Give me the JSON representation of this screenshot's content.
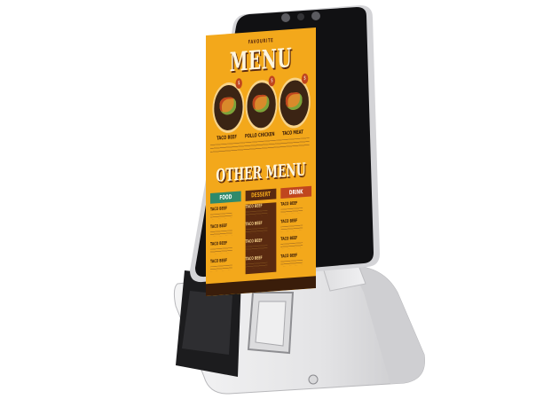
{
  "screen": {
    "brand": "FAVOURITE",
    "title": "MENU",
    "featured": [
      {
        "label": "TACO BEEF",
        "price": "$"
      },
      {
        "label": "POLLO CHICKEN",
        "price": "$"
      },
      {
        "label": "TACO MEAT",
        "price": "$"
      }
    ],
    "section_title": "OTHER MENU",
    "categories": [
      {
        "label": "FOOD",
        "color": "#2f8a6b"
      },
      {
        "label": "DESSERT",
        "color": "#5a2a10"
      },
      {
        "label": "DRINK",
        "color": "#c0461e"
      }
    ],
    "item_name": "TACO BEEF"
  },
  "colors": {
    "screen_bg": "#f3a81b",
    "body": "#e9e9ea",
    "bezel": "#111111"
  }
}
